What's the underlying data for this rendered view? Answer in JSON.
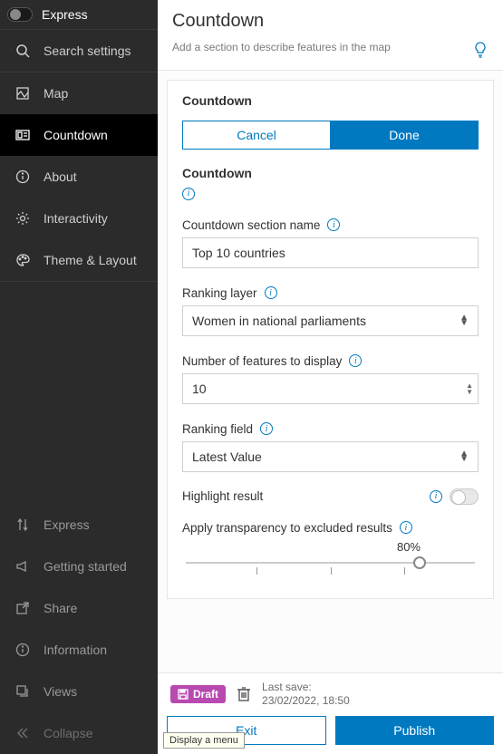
{
  "sidebar": {
    "express_label": "Express",
    "search_label": "Search settings",
    "nav": {
      "map": "Map",
      "countdown": "Countdown",
      "about": "About",
      "interactivity": "Interactivity",
      "theme_layout": "Theme & Layout"
    },
    "footer_nav": {
      "express": "Express",
      "getting_started": "Getting started",
      "share": "Share",
      "information": "Information",
      "views": "Views",
      "collapse": "Collapse"
    }
  },
  "header": {
    "title": "Countdown",
    "description": "Add a section to describe features in the map"
  },
  "panel": {
    "title": "Countdown",
    "cancel": "Cancel",
    "done": "Done",
    "subhead": "Countdown",
    "fields": {
      "section_name": {
        "label": "Countdown section name",
        "value": "Top 10 countries"
      },
      "ranking_layer": {
        "label": "Ranking layer",
        "value": "Women in national parliaments"
      },
      "num_features": {
        "label": "Number of features to display",
        "value": "10"
      },
      "ranking_field": {
        "label": "Ranking field",
        "value": "Latest Value"
      },
      "highlight": {
        "label": "Highlight result",
        "on": false
      },
      "transparency": {
        "label": "Apply transparency to excluded results",
        "value": "80%"
      }
    }
  },
  "footer": {
    "draft": "Draft",
    "last_save_label": "Last save:",
    "last_save_value": "23/02/2022, 18:50",
    "exit": "Exit",
    "publish": "Publish"
  },
  "tooltip": "Display a menu"
}
